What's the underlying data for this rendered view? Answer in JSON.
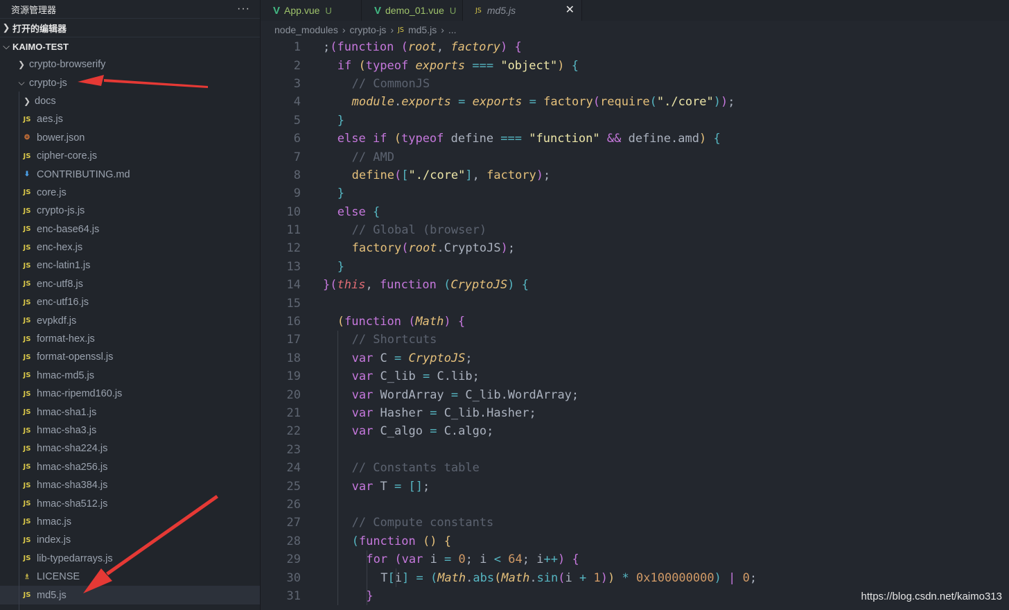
{
  "sidebar": {
    "title": "资源管理器",
    "more_label": "···",
    "open_editors_label": "打开的编辑器",
    "project_label": "KAIMO-TEST",
    "items": [
      {
        "label": "crypto-browserify",
        "type": "folder",
        "expanded": false,
        "depth": 1
      },
      {
        "label": "crypto-js",
        "type": "folder",
        "expanded": true,
        "depth": 1
      },
      {
        "label": "docs",
        "type": "folder",
        "expanded": false,
        "depth": 2
      },
      {
        "label": "aes.js",
        "type": "js",
        "depth": 2
      },
      {
        "label": "bower.json",
        "type": "json",
        "depth": 2
      },
      {
        "label": "cipher-core.js",
        "type": "js",
        "depth": 2
      },
      {
        "label": "CONTRIBUTING.md",
        "type": "md",
        "depth": 2
      },
      {
        "label": "core.js",
        "type": "js",
        "depth": 2
      },
      {
        "label": "crypto-js.js",
        "type": "js",
        "depth": 2
      },
      {
        "label": "enc-base64.js",
        "type": "js",
        "depth": 2
      },
      {
        "label": "enc-hex.js",
        "type": "js",
        "depth": 2
      },
      {
        "label": "enc-latin1.js",
        "type": "js",
        "depth": 2
      },
      {
        "label": "enc-utf8.js",
        "type": "js",
        "depth": 2
      },
      {
        "label": "enc-utf16.js",
        "type": "js",
        "depth": 2
      },
      {
        "label": "evpkdf.js",
        "type": "js",
        "depth": 2
      },
      {
        "label": "format-hex.js",
        "type": "js",
        "depth": 2
      },
      {
        "label": "format-openssl.js",
        "type": "js",
        "depth": 2
      },
      {
        "label": "hmac-md5.js",
        "type": "js",
        "depth": 2
      },
      {
        "label": "hmac-ripemd160.js",
        "type": "js",
        "depth": 2
      },
      {
        "label": "hmac-sha1.js",
        "type": "js",
        "depth": 2
      },
      {
        "label": "hmac-sha3.js",
        "type": "js",
        "depth": 2
      },
      {
        "label": "hmac-sha224.js",
        "type": "js",
        "depth": 2
      },
      {
        "label": "hmac-sha256.js",
        "type": "js",
        "depth": 2
      },
      {
        "label": "hmac-sha384.js",
        "type": "js",
        "depth": 2
      },
      {
        "label": "hmac-sha512.js",
        "type": "js",
        "depth": 2
      },
      {
        "label": "hmac.js",
        "type": "js",
        "depth": 2
      },
      {
        "label": "index.js",
        "type": "js",
        "depth": 2
      },
      {
        "label": "lib-typedarrays.js",
        "type": "js",
        "depth": 2
      },
      {
        "label": "LICENSE",
        "type": "license",
        "depth": 2
      },
      {
        "label": "md5.js",
        "type": "js",
        "depth": 2,
        "selected": true
      }
    ]
  },
  "tabs": [
    {
      "label": "App.vue",
      "status": "U",
      "icon": "vue-icon",
      "active": false
    },
    {
      "label": "demo_01.vue",
      "status": "U",
      "icon": "vue-icon",
      "active": false
    },
    {
      "label": "md5.js",
      "status": "",
      "icon": "js-icon",
      "active": true,
      "close": "✕"
    }
  ],
  "js_badge": "JS",
  "breadcrumb": [
    "node_modules",
    "crypto-js",
    "md5.js",
    "..."
  ],
  "code_lines": [
    {
      "n": "1",
      "indent": 0,
      "tokens": [
        [
          "",
          ";"
        ],
        [
          "pl",
          "("
        ],
        [
          "k",
          "function"
        ],
        [
          "",
          " "
        ],
        [
          "pl",
          "("
        ],
        [
          "p",
          "root"
        ],
        [
          "",
          ", "
        ],
        [
          "p",
          "factory"
        ],
        [
          "pl",
          ")"
        ],
        [
          "",
          " "
        ],
        [
          "pl",
          "{"
        ]
      ]
    },
    {
      "n": "2",
      "indent": 1,
      "tokens": [
        [
          "k",
          "if"
        ],
        [
          "",
          " "
        ],
        [
          "f",
          "("
        ],
        [
          "k",
          "typeof"
        ],
        [
          "",
          " "
        ],
        [
          "p",
          "exports"
        ],
        [
          "",
          " "
        ],
        [
          "o",
          "==="
        ],
        [
          "",
          " "
        ],
        [
          "s",
          "\"object\""
        ],
        [
          "f",
          ")"
        ],
        [
          "",
          " "
        ],
        [
          "o",
          "{"
        ]
      ]
    },
    {
      "n": "3",
      "indent": 2,
      "tokens": [
        [
          "c",
          "// CommonJS"
        ]
      ]
    },
    {
      "n": "4",
      "indent": 2,
      "tokens": [
        [
          "p",
          "module"
        ],
        [
          "",
          "."
        ],
        [
          "p",
          "exports"
        ],
        [
          "",
          " "
        ],
        [
          "o",
          "="
        ],
        [
          "",
          " "
        ],
        [
          "p",
          "exports"
        ],
        [
          "",
          " "
        ],
        [
          "o",
          "="
        ],
        [
          "",
          " "
        ],
        [
          "f",
          "factory"
        ],
        [
          "k",
          "("
        ],
        [
          "f",
          "require"
        ],
        [
          "o",
          "("
        ],
        [
          "s",
          "\"./core\""
        ],
        [
          "o",
          ")"
        ],
        [
          "k",
          ")"
        ],
        [
          "",
          ";"
        ]
      ]
    },
    {
      "n": "5",
      "indent": 1,
      "tokens": [
        [
          "o",
          "}"
        ]
      ]
    },
    {
      "n": "6",
      "indent": 1,
      "tokens": [
        [
          "k",
          "else"
        ],
        [
          "",
          " "
        ],
        [
          "k",
          "if"
        ],
        [
          "",
          " "
        ],
        [
          "f",
          "("
        ],
        [
          "k",
          "typeof"
        ],
        [
          "",
          " define "
        ],
        [
          "o",
          "==="
        ],
        [
          "",
          " "
        ],
        [
          "s",
          "\"function\""
        ],
        [
          "",
          " "
        ],
        [
          "k",
          "&&"
        ],
        [
          "",
          " define.amd"
        ],
        [
          "f",
          ")"
        ],
        [
          "",
          " "
        ],
        [
          "o",
          "{"
        ]
      ]
    },
    {
      "n": "7",
      "indent": 2,
      "tokens": [
        [
          "c",
          "// AMD"
        ]
      ]
    },
    {
      "n": "8",
      "indent": 2,
      "tokens": [
        [
          "f",
          "define"
        ],
        [
          "k",
          "("
        ],
        [
          "o",
          "["
        ],
        [
          "s",
          "\"./core\""
        ],
        [
          "o",
          "]"
        ],
        [
          "",
          ", "
        ],
        [
          "f",
          "factory"
        ],
        [
          "k",
          ")"
        ],
        [
          "",
          ";"
        ]
      ]
    },
    {
      "n": "9",
      "indent": 1,
      "tokens": [
        [
          "o",
          "}"
        ]
      ]
    },
    {
      "n": "10",
      "indent": 1,
      "tokens": [
        [
          "k",
          "else"
        ],
        [
          "",
          " "
        ],
        [
          "o",
          "{"
        ]
      ]
    },
    {
      "n": "11",
      "indent": 2,
      "tokens": [
        [
          "c",
          "// Global (browser)"
        ]
      ]
    },
    {
      "n": "12",
      "indent": 2,
      "tokens": [
        [
          "f",
          "factory"
        ],
        [
          "k",
          "("
        ],
        [
          "p",
          "root"
        ],
        [
          "",
          ".CryptoJS"
        ],
        [
          "k",
          ")"
        ],
        [
          "",
          ";"
        ]
      ]
    },
    {
      "n": "13",
      "indent": 1,
      "tokens": [
        [
          "o",
          "}"
        ]
      ]
    },
    {
      "n": "14",
      "indent": 0,
      "tokens": [
        [
          "pl",
          "}"
        ],
        [
          "pl",
          "("
        ],
        [
          "t",
          "this"
        ],
        [
          "",
          ", "
        ],
        [
          "k",
          "function"
        ],
        [
          "",
          " "
        ],
        [
          "o",
          "("
        ],
        [
          "p",
          "CryptoJS"
        ],
        [
          "o",
          ")"
        ],
        [
          "",
          " "
        ],
        [
          "o",
          "{"
        ]
      ]
    },
    {
      "n": "15",
      "indent": 0,
      "tokens": []
    },
    {
      "n": "16",
      "indent": 1,
      "tokens": [
        [
          "f",
          "("
        ],
        [
          "k",
          "function"
        ],
        [
          "",
          " "
        ],
        [
          "k",
          "("
        ],
        [
          "p",
          "Math"
        ],
        [
          "k",
          ")"
        ],
        [
          "",
          " "
        ],
        [
          "k",
          "{"
        ]
      ]
    },
    {
      "n": "17",
      "indent": 2,
      "guides": 1,
      "tokens": [
        [
          "c",
          "// Shortcuts"
        ]
      ]
    },
    {
      "n": "18",
      "indent": 2,
      "guides": 1,
      "tokens": [
        [
          "k",
          "var"
        ],
        [
          "",
          " C "
        ],
        [
          "o",
          "="
        ],
        [
          "",
          " "
        ],
        [
          "p",
          "CryptoJS"
        ],
        [
          "",
          ";"
        ]
      ]
    },
    {
      "n": "19",
      "indent": 2,
      "guides": 1,
      "tokens": [
        [
          "k",
          "var"
        ],
        [
          "",
          " C_lib "
        ],
        [
          "o",
          "="
        ],
        [
          "",
          " C.lib;"
        ]
      ]
    },
    {
      "n": "20",
      "indent": 2,
      "guides": 1,
      "tokens": [
        [
          "k",
          "var"
        ],
        [
          "",
          " WordArray "
        ],
        [
          "o",
          "="
        ],
        [
          "",
          " C_lib.WordArray;"
        ]
      ]
    },
    {
      "n": "21",
      "indent": 2,
      "guides": 1,
      "tokens": [
        [
          "k",
          "var"
        ],
        [
          "",
          " Hasher "
        ],
        [
          "o",
          "="
        ],
        [
          "",
          " C_lib.Hasher;"
        ]
      ]
    },
    {
      "n": "22",
      "indent": 2,
      "guides": 1,
      "tokens": [
        [
          "k",
          "var"
        ],
        [
          "",
          " C_algo "
        ],
        [
          "o",
          "="
        ],
        [
          "",
          " C.algo;"
        ]
      ]
    },
    {
      "n": "23",
      "indent": 2,
      "guides": 1,
      "tokens": []
    },
    {
      "n": "24",
      "indent": 2,
      "guides": 1,
      "tokens": [
        [
          "c",
          "// Constants table"
        ]
      ]
    },
    {
      "n": "25",
      "indent": 2,
      "guides": 1,
      "tokens": [
        [
          "k",
          "var"
        ],
        [
          "",
          " T "
        ],
        [
          "o",
          "="
        ],
        [
          "",
          " "
        ],
        [
          "o",
          "[]"
        ],
        [
          "",
          ";"
        ]
      ]
    },
    {
      "n": "26",
      "indent": 2,
      "guides": 1,
      "tokens": []
    },
    {
      "n": "27",
      "indent": 2,
      "guides": 1,
      "tokens": [
        [
          "c",
          "// Compute constants"
        ]
      ]
    },
    {
      "n": "28",
      "indent": 2,
      "guides": 1,
      "tokens": [
        [
          "o",
          "("
        ],
        [
          "k",
          "function"
        ],
        [
          "",
          " "
        ],
        [
          "f",
          "()"
        ],
        [
          "",
          " "
        ],
        [
          "f",
          "{"
        ]
      ]
    },
    {
      "n": "29",
      "indent": 3,
      "guides": 2,
      "tokens": [
        [
          "k",
          "for"
        ],
        [
          "",
          " "
        ],
        [
          "k",
          "("
        ],
        [
          "k",
          "var"
        ],
        [
          "",
          " i "
        ],
        [
          "o",
          "="
        ],
        [
          "",
          " "
        ],
        [
          "n",
          "0"
        ],
        [
          "",
          "; i "
        ],
        [
          "o",
          "<"
        ],
        [
          "",
          " "
        ],
        [
          "n",
          "64"
        ],
        [
          "",
          "; i"
        ],
        [
          "o",
          "++"
        ],
        [
          "k",
          ")"
        ],
        [
          "",
          " "
        ],
        [
          "k",
          "{"
        ]
      ]
    },
    {
      "n": "30",
      "indent": 4,
      "guides": 3,
      "tokens": [
        [
          "",
          "T"
        ],
        [
          "o",
          "["
        ],
        [
          "",
          "i"
        ],
        [
          "o",
          "]"
        ],
        [
          "",
          " "
        ],
        [
          "o",
          "="
        ],
        [
          "",
          " "
        ],
        [
          "o",
          "("
        ],
        [
          "p",
          "Math"
        ],
        [
          "",
          "."
        ],
        [
          "o",
          "abs"
        ],
        [
          "f",
          "("
        ],
        [
          "p",
          "Math"
        ],
        [
          "",
          "."
        ],
        [
          "o",
          "sin"
        ],
        [
          "k",
          "("
        ],
        [
          "",
          "i "
        ],
        [
          "o",
          "+"
        ],
        [
          "",
          " "
        ],
        [
          "n",
          "1"
        ],
        [
          "k",
          ")"
        ],
        [
          "f",
          ")"
        ],
        [
          "",
          " "
        ],
        [
          "o",
          "*"
        ],
        [
          "",
          " "
        ],
        [
          "n",
          "0x100000000"
        ],
        [
          "o",
          ")"
        ],
        [
          "",
          " "
        ],
        [
          "k",
          "|"
        ],
        [
          "",
          " "
        ],
        [
          "n",
          "0"
        ],
        [
          "",
          ";"
        ]
      ]
    },
    {
      "n": "31",
      "indent": 3,
      "guides": 2,
      "tokens": [
        [
          "k",
          "}"
        ]
      ]
    }
  ],
  "watermark": "https://blog.csdn.net/kaimo313",
  "colors": {
    "accent_red": "#e53935",
    "vue_green": "#42b883",
    "js_yellow": "#d9c74a"
  }
}
